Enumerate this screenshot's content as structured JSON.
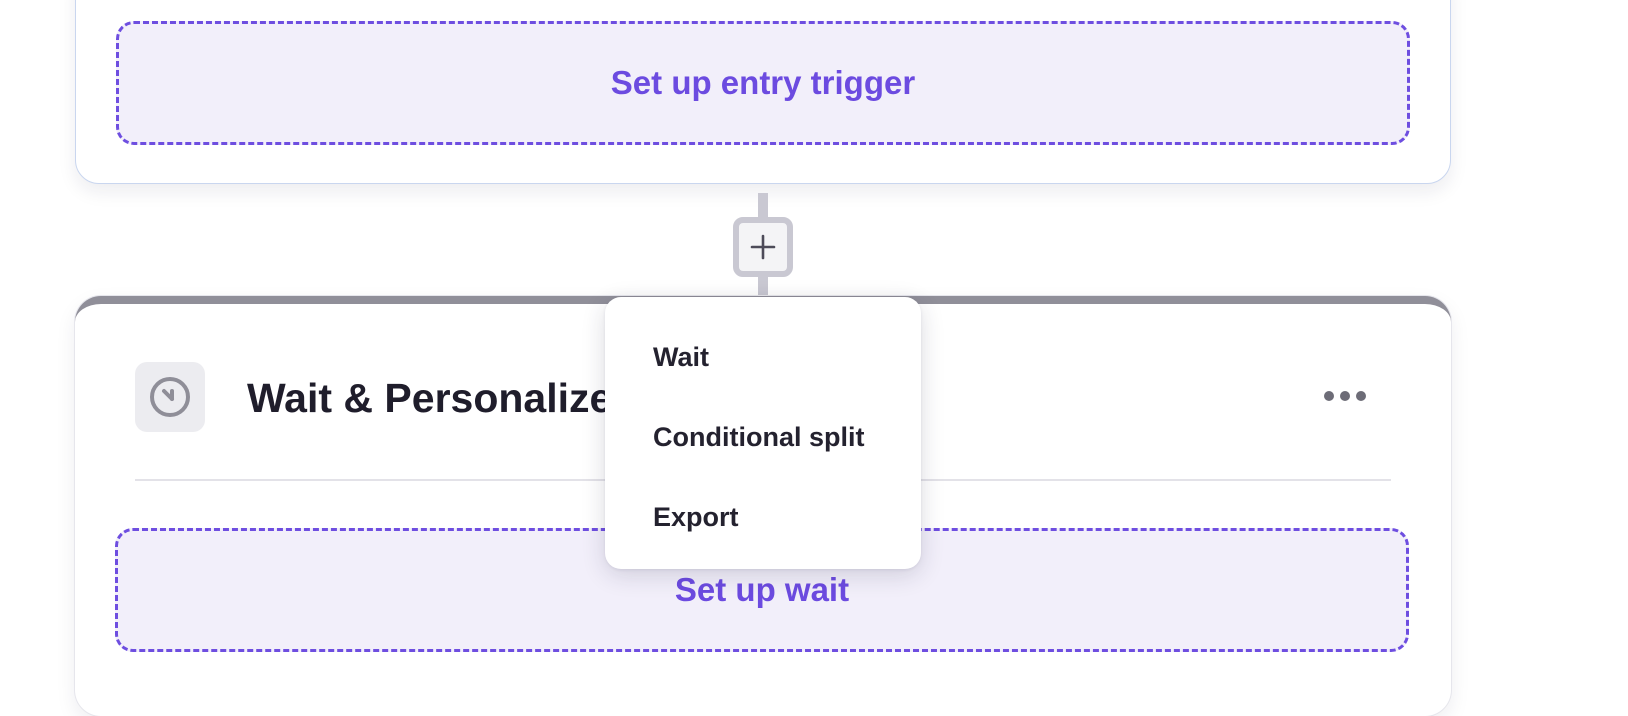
{
  "entry_card": {
    "slot_label": "Set up entry trigger"
  },
  "connector": {
    "add_icon": "plus-icon"
  },
  "node": {
    "title": "Wait & Personalize",
    "icon": "clock-icon",
    "menu_icon": "more-horizontal-icon",
    "slot_label": "Set up wait"
  },
  "dropdown": {
    "items": [
      {
        "label": "Wait"
      },
      {
        "label": "Conditional split"
      },
      {
        "label": "Export"
      }
    ]
  },
  "colors": {
    "accent": "#6c4be0",
    "slot_background": "#f2effa",
    "node_header_bar": "#908f99",
    "connector": "#c9c8d2"
  }
}
